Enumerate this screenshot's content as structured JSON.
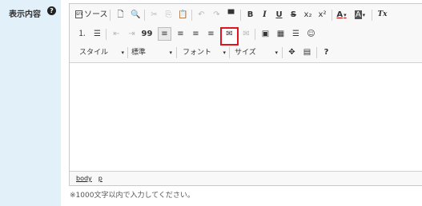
{
  "field": {
    "label": "表示内容",
    "help_icon": "?"
  },
  "toolbar": {
    "row1": {
      "source_label": "ソース",
      "source_icon": "src",
      "new_page": "🗋",
      "preview": "🔍",
      "cut": "✂",
      "copy": "⎘",
      "paste": "📋",
      "undo": "↶",
      "redo": "↷",
      "page_break": "▀",
      "bold": "B",
      "italic": "I",
      "underline": "U",
      "strike": "S",
      "subscript": "x₂",
      "superscript": "x²",
      "text_color": "A",
      "bg_color": "A",
      "remove_format": "Tx"
    },
    "row2": {
      "numbered_list": "⒈",
      "bullet_list": "☰",
      "outdent": "⇤",
      "indent": "⇥",
      "blockquote": "99",
      "align_left": "≡",
      "align_center": "≡",
      "align_right": "≡",
      "align_justify": "≡",
      "link": "✉",
      "unlink": "✉",
      "image": "▣",
      "table": "▦",
      "horizontal_rule": "☰",
      "smiley": "☺"
    },
    "row3": {
      "style": "スタイル",
      "format": "標準",
      "font": "フォント",
      "size": "サイズ",
      "maximize": "✥",
      "show_blocks": "▤",
      "about": "?"
    }
  },
  "pathbar": {
    "body": "body",
    "p": "p"
  },
  "note": "※1000文字以内で入力してください。"
}
